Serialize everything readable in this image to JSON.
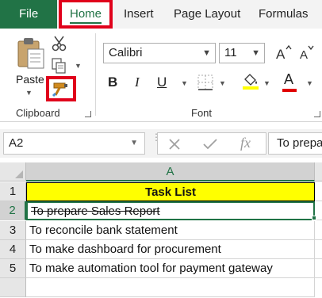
{
  "ribbon": {
    "tabs": {
      "file": "File",
      "home": "Home",
      "insert": "Insert",
      "page_layout": "Page Layout",
      "formulas": "Formulas"
    },
    "clipboard": {
      "paste_label": "Paste",
      "group_label": "Clipboard",
      "icons": [
        "paste-icon",
        "cut-icon",
        "copy-icon",
        "format-painter-icon"
      ]
    },
    "font": {
      "font_name": "Calibri",
      "font_size": "11",
      "bold": "B",
      "italic": "I",
      "underline": "U",
      "font_color_label": "A",
      "group_label": "Font",
      "icons": [
        "grow-font-icon",
        "shrink-font-icon",
        "borders-icon",
        "fill-color-icon",
        "font-color-icon"
      ]
    },
    "colors": {
      "accent": "#217346",
      "highlight_box": "#e0001b",
      "fill_color_bar": "#ffff00",
      "font_color_bar": "#e00000"
    }
  },
  "formula_bar": {
    "name_box": "A2",
    "fx_label": "fx",
    "formula_text": "To prepare Sales Report"
  },
  "sheet": {
    "column_header": "A",
    "rows": [
      {
        "row": "1",
        "text": "Task List",
        "style": "header"
      },
      {
        "row": "2",
        "text": "To prepare Sales Report",
        "style": "strikethrough-selected"
      },
      {
        "row": "3",
        "text": "To reconcile bank statement",
        "style": "normal"
      },
      {
        "row": "4",
        "text": "To make dashboard for procurement",
        "style": "normal"
      },
      {
        "row": "5",
        "text": "To make automation tool for payment gateway",
        "style": "normal"
      }
    ],
    "header_fill": "#ffff00"
  }
}
